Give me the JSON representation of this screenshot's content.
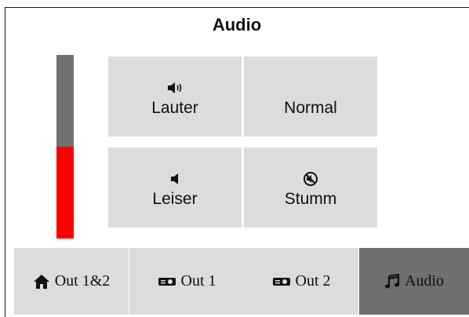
{
  "title": "Audio",
  "volume_level": 0.5,
  "colors": {
    "meter_fill": "#ff0000",
    "meter_track": "#727272",
    "button_bg": "#dcdcdc",
    "active_tab": "#6f6f6f"
  },
  "buttons": [
    {
      "label": "Lauter",
      "icon": "volume-up-icon"
    },
    {
      "label": "Normal",
      "icon": ""
    },
    {
      "label": "Leiser",
      "icon": "volume-down-icon"
    },
    {
      "label": "Stumm",
      "icon": "mute-icon"
    }
  ],
  "nav": [
    {
      "label": "Out 1&2",
      "icon": "home-icon",
      "active": false
    },
    {
      "label": "Out 1",
      "icon": "projector-icon",
      "active": false
    },
    {
      "label": "Out 2",
      "icon": "projector-icon",
      "active": false
    },
    {
      "label": "Audio",
      "icon": "music-note-icon",
      "active": true
    }
  ]
}
